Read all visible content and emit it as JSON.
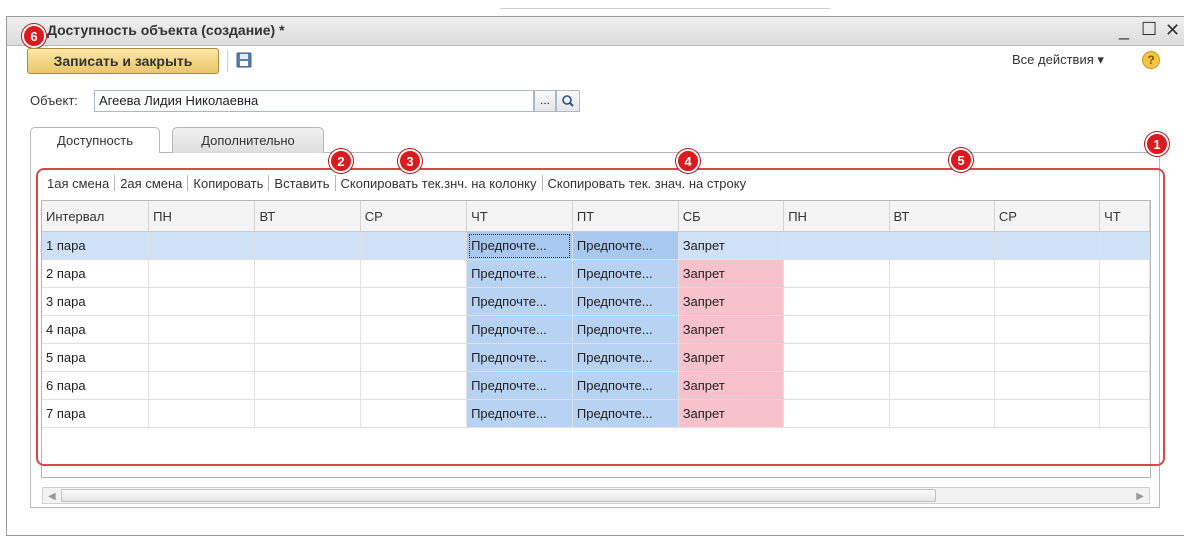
{
  "window": {
    "title": "Доступность объекта (создание) *",
    "minimize": "_",
    "maximize": "☐",
    "close": "✕"
  },
  "toolbar": {
    "save_close_label": "Записать и закрыть",
    "save_icon": "floppy-disk-icon",
    "all_actions_label": "Все действия ▾",
    "help_label": "?"
  },
  "object_field": {
    "label": "Объект:",
    "value": "Агеева Лидия Николаевна",
    "select_button": "...",
    "search_icon": "magnifier-icon"
  },
  "tabs": [
    {
      "label": "Доступность",
      "active": true
    },
    {
      "label": "Дополнительно",
      "active": false
    }
  ],
  "command_bar": [
    "1ая смена",
    "2ая смена",
    "Копировать",
    "Вставить",
    "Скопировать тек.знч. на колонку",
    "Скопировать тек. знач. на строку"
  ],
  "table": {
    "columns": [
      "Интервал",
      "ПН",
      "ВТ",
      "СР",
      "ЧТ",
      "ПТ",
      "СБ",
      "ПН",
      "ВТ",
      "СР",
      "ЧТ"
    ],
    "rows": [
      [
        "1 пара",
        "",
        "",
        "",
        "Предпочте...",
        "Предпочте...",
        "Запрет",
        "",
        "",
        "",
        ""
      ],
      [
        "2 пара",
        "",
        "",
        "",
        "Предпочте...",
        "Предпочте...",
        "Запрет",
        "",
        "",
        "",
        ""
      ],
      [
        "3 пара",
        "",
        "",
        "",
        "Предпочте...",
        "Предпочте...",
        "Запрет",
        "",
        "",
        "",
        ""
      ],
      [
        "4 пара",
        "",
        "",
        "",
        "Предпочте...",
        "Предпочте...",
        "Запрет",
        "",
        "",
        "",
        ""
      ],
      [
        "5 пара",
        "",
        "",
        "",
        "Предпочте...",
        "Предпочте...",
        "Запрет",
        "",
        "",
        "",
        ""
      ],
      [
        "6 пара",
        "",
        "",
        "",
        "Предпочте...",
        "Предпочте...",
        "Запрет",
        "",
        "",
        "",
        ""
      ],
      [
        "7 пара",
        "",
        "",
        "",
        "Предпочте...",
        "Предпочте...",
        "Запрет",
        "",
        "",
        "",
        ""
      ]
    ],
    "selected_row": 0
  },
  "annotations": [
    "1",
    "2",
    "3",
    "4",
    "5",
    "6"
  ],
  "colors": {
    "preferred": "#b8d2f3",
    "forbidden": "#f8c2cd",
    "selection": "#cfe1f7",
    "annotation_red": "#d91b1f"
  }
}
